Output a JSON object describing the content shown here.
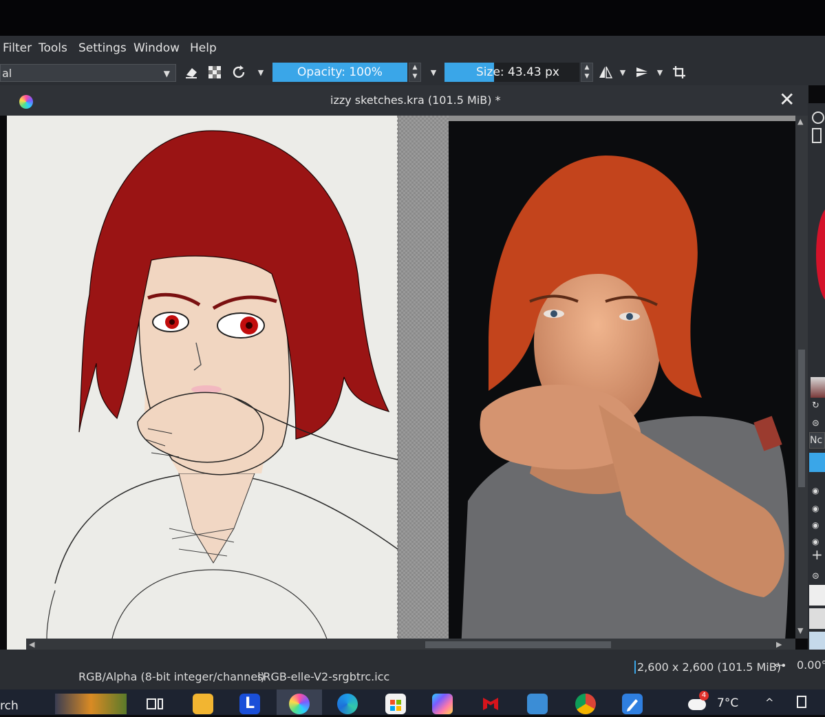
{
  "menu": {
    "items": [
      "Filter",
      "Tools",
      "Settings",
      "Window",
      "Help"
    ]
  },
  "toolbar": {
    "blend_mode": "al",
    "opacity_label": "Opacity: 100%",
    "size_label": "Size: 43.43 px"
  },
  "document": {
    "title": "izzy sketches.kra (101.5 MiB) *"
  },
  "right_panel": {
    "blend_label": "Nc"
  },
  "status": {
    "color_space": "RGB/Alpha (8-bit integer/channel)",
    "profile": "sRGB-elle-V2-srgbtrc.icc",
    "dimensions": "2,600 x 2,600 (101.5 MiB)",
    "rotation": "0.00°"
  },
  "taskbar": {
    "search_fragment": "rch",
    "weather_temp": "7°C",
    "weather_badge": "4",
    "launcher_letter": "L"
  },
  "colors": {
    "accent": "#3aa6e8",
    "panel": "#2b2e33",
    "hair_drawing": "#9a1414",
    "hair_photo": "#c3441c"
  }
}
